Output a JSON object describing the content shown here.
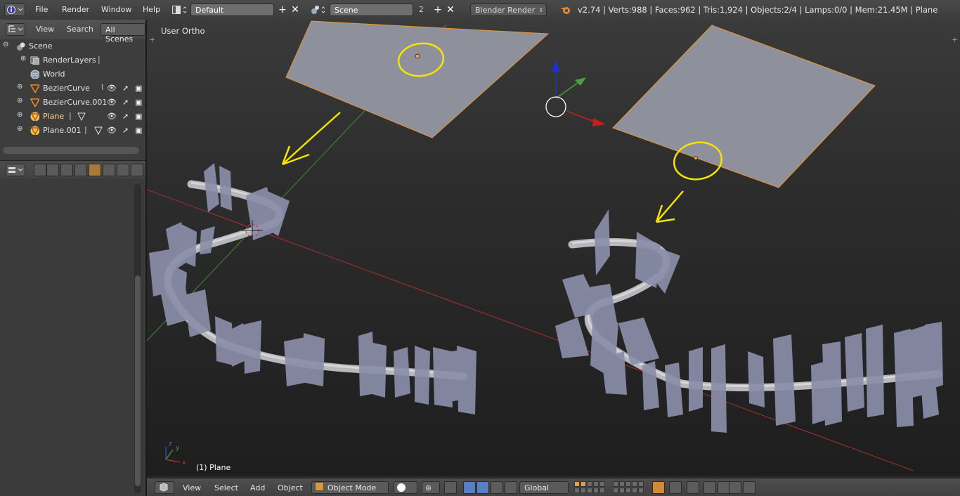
{
  "topbar": {
    "menus": [
      "File",
      "Render",
      "Window",
      "Help"
    ],
    "screen_layout": "Default",
    "scene": "Scene",
    "scene_users": "2",
    "render_engine": "Blender Render",
    "stats": "v2.74 | Verts:988 | Faces:962 | Tris:1,924 | Objects:2/4 | Lamps:0/0 | Mem:21.45M | Plane"
  },
  "outliner": {
    "header": {
      "view": "View",
      "search": "Search",
      "filter": "All Scenes"
    },
    "items": [
      {
        "label": "Scene",
        "icon": "scene-icon"
      },
      {
        "label": "RenderLayers",
        "icon": "renderlayers-icon"
      },
      {
        "label": "World",
        "icon": "world-icon"
      },
      {
        "label": "BezierCurve",
        "icon": "curve-object-icon"
      },
      {
        "label": "BezierCurve.001",
        "icon": "curve-object-icon"
      },
      {
        "label": "Plane",
        "icon": "mesh-object-icon",
        "active": true
      },
      {
        "label": "Plane.001",
        "icon": "mesh-object-icon"
      }
    ]
  },
  "viewport": {
    "view_label": "User Ortho",
    "object_label": "(1) Plane",
    "axis_labels": {
      "x": "x",
      "y": "y",
      "z": "z"
    }
  },
  "bottombar": {
    "menus": [
      "View",
      "Select",
      "Add",
      "Object"
    ],
    "mode": "Object Mode",
    "orientation": "Global"
  },
  "colors": {
    "selection_outline": "#f0a030",
    "annotation_yellow": "#f5e400",
    "x_axis_red": "#b03030",
    "y_axis_green": "#4a9a3a",
    "z_axis_blue": "#2030d0",
    "mesh_fill": "#8c8e9c",
    "active_text": "#ffd68a"
  }
}
